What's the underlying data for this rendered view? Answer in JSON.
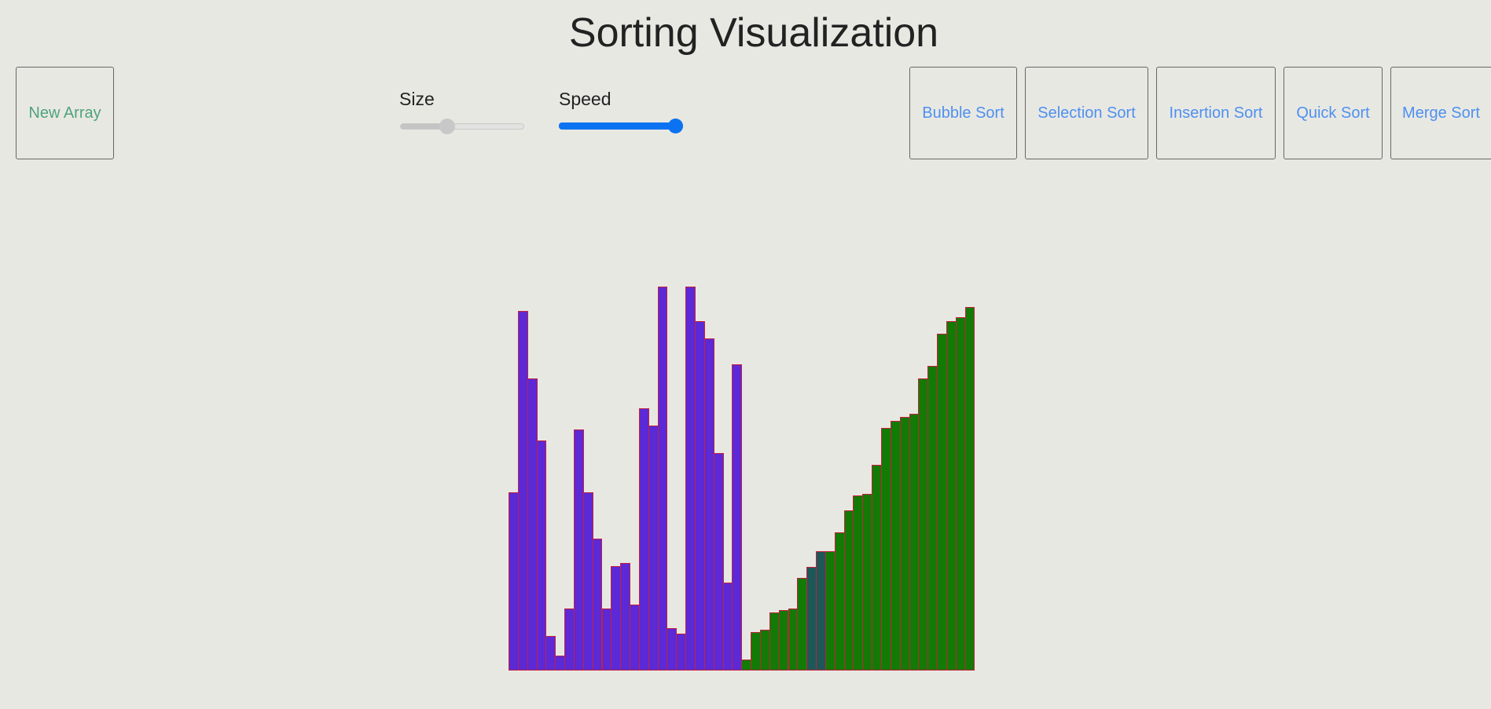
{
  "app": {
    "title": "Sorting Visualization"
  },
  "toolbar": {
    "new_array_label": "New Array",
    "sort_buttons": [
      {
        "label": "Bubble Sort"
      },
      {
        "label": "Selection Sort"
      },
      {
        "label": "Insertion Sort"
      },
      {
        "label": "Quick Sort"
      },
      {
        "label": "Merge Sort"
      }
    ]
  },
  "controls": {
    "size": {
      "label": "Size",
      "value_fraction": 0.36
    },
    "speed": {
      "label": "Speed",
      "value_fraction": 1.0
    }
  },
  "colors": {
    "unsorted": "#5b29d6",
    "sorted": "#137a06",
    "active": "#1d5858",
    "border": "#c4213e",
    "button_new": "#4fa37a",
    "button_sort": "#4e90ef",
    "slider_accent": "#0b73f2"
  },
  "bars": [
    {
      "value": 227,
      "state": "unsorted"
    },
    {
      "value": 458,
      "state": "unsorted"
    },
    {
      "value": 372,
      "state": "unsorted"
    },
    {
      "value": 293,
      "state": "unsorted"
    },
    {
      "value": 44,
      "state": "unsorted"
    },
    {
      "value": 19,
      "state": "unsorted"
    },
    {
      "value": 79,
      "state": "unsorted"
    },
    {
      "value": 307,
      "state": "unsorted"
    },
    {
      "value": 227,
      "state": "unsorted"
    },
    {
      "value": 168,
      "state": "unsorted"
    },
    {
      "value": 79,
      "state": "unsorted"
    },
    {
      "value": 133,
      "state": "unsorted"
    },
    {
      "value": 137,
      "state": "unsorted"
    },
    {
      "value": 84,
      "state": "unsorted"
    },
    {
      "value": 334,
      "state": "unsorted"
    },
    {
      "value": 312,
      "state": "unsorted"
    },
    {
      "value": 489,
      "state": "unsorted"
    },
    {
      "value": 54,
      "state": "unsorted"
    },
    {
      "value": 47,
      "state": "unsorted"
    },
    {
      "value": 489,
      "state": "unsorted"
    },
    {
      "value": 445,
      "state": "unsorted"
    },
    {
      "value": 423,
      "state": "unsorted"
    },
    {
      "value": 277,
      "state": "unsorted"
    },
    {
      "value": 112,
      "state": "unsorted"
    },
    {
      "value": 390,
      "state": "unsorted"
    },
    {
      "value": 14,
      "state": "sorted"
    },
    {
      "value": 49,
      "state": "sorted"
    },
    {
      "value": 52,
      "state": "sorted"
    },
    {
      "value": 74,
      "state": "sorted"
    },
    {
      "value": 77,
      "state": "sorted"
    },
    {
      "value": 79,
      "state": "sorted"
    },
    {
      "value": 118,
      "state": "sorted"
    },
    {
      "value": 132,
      "state": "active"
    },
    {
      "value": 152,
      "state": "active"
    },
    {
      "value": 152,
      "state": "sorted"
    },
    {
      "value": 176,
      "state": "sorted"
    },
    {
      "value": 204,
      "state": "sorted"
    },
    {
      "value": 223,
      "state": "sorted"
    },
    {
      "value": 225,
      "state": "sorted"
    },
    {
      "value": 262,
      "state": "sorted"
    },
    {
      "value": 309,
      "state": "sorted"
    },
    {
      "value": 318,
      "state": "sorted"
    },
    {
      "value": 323,
      "state": "sorted"
    },
    {
      "value": 327,
      "state": "sorted"
    },
    {
      "value": 372,
      "state": "sorted"
    },
    {
      "value": 388,
      "state": "sorted"
    },
    {
      "value": 429,
      "state": "sorted"
    },
    {
      "value": 445,
      "state": "sorted"
    },
    {
      "value": 450,
      "state": "sorted"
    },
    {
      "value": 463,
      "state": "sorted"
    }
  ]
}
